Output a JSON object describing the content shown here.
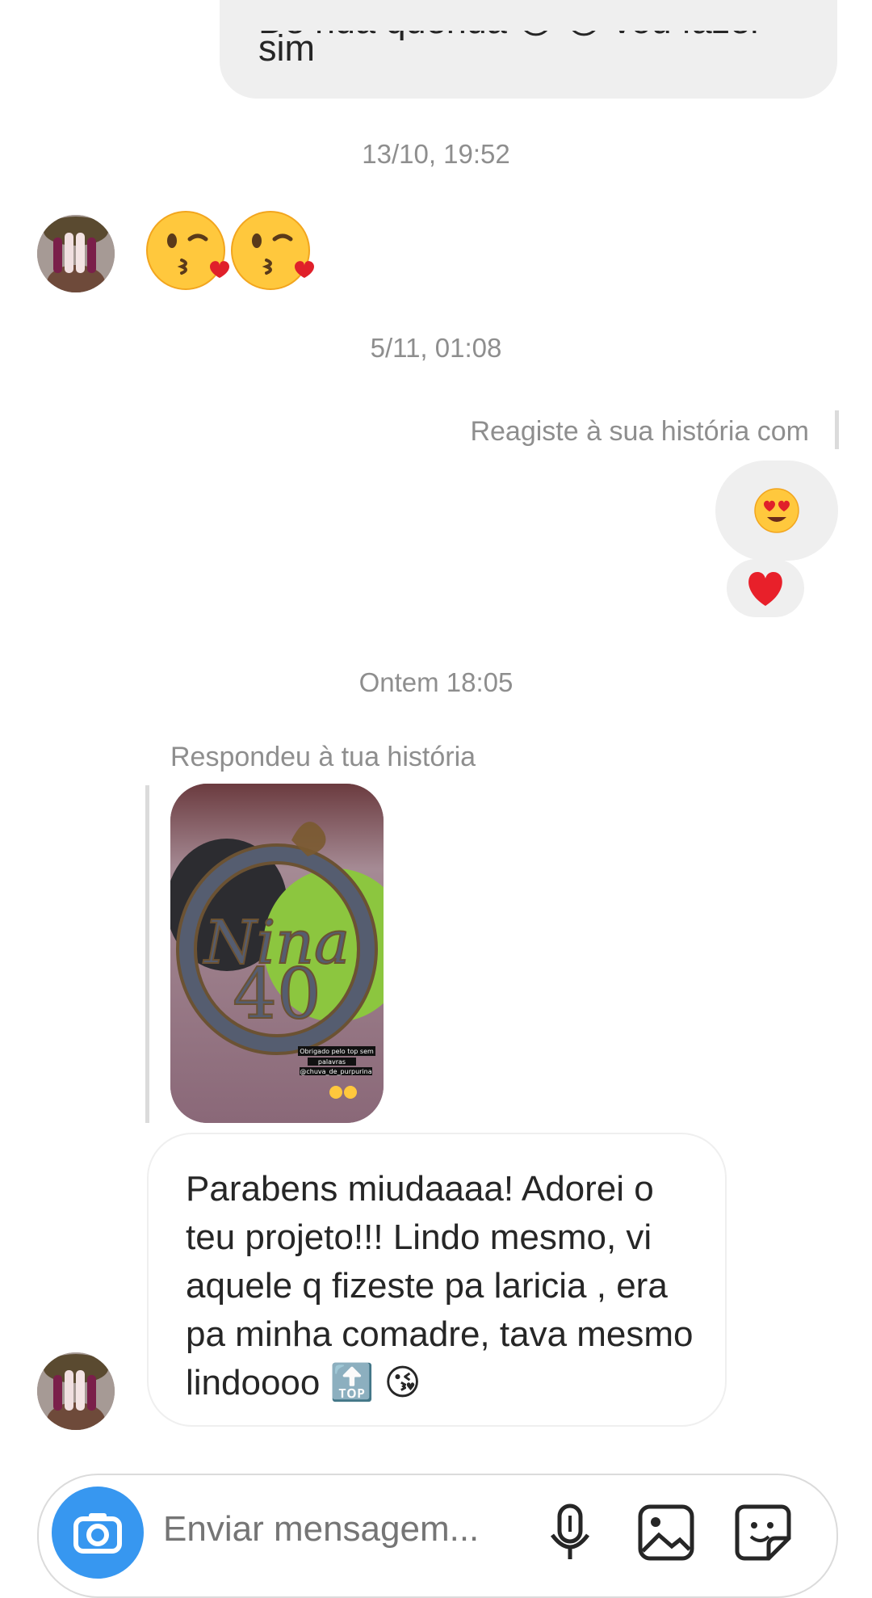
{
  "thread": {
    "top_message": {
      "partial_line": "De nua quenua 😘 😘 vou fazer",
      "text": "sim"
    },
    "timestamps": [
      "13/10, 19:52",
      "5/11, 01:08",
      "Ontem 18:05"
    ],
    "reaction": {
      "label": "Reagiste à sua história com",
      "emoji": "😍",
      "heart": "❤️"
    },
    "story_reply": {
      "label": "Respondeu à tua história",
      "story_caption_line1": "Obrigado pelo top sem",
      "story_caption_line2": "palavras",
      "story_caption_line3": "@chuva_de_purpurina",
      "message": "Parabens miudaaaa! Adorei o teu projeto!!! Lindo mesmo, vi aquele q fizeste pa laricia , era pa minha comadre, tava mesmo lindoooo 🔝 😘"
    }
  },
  "composer": {
    "placeholder": "Enviar mensagem..."
  },
  "colors": {
    "accent": "#3797f0",
    "bubble": "#efefef",
    "timestamp": "#8e8e8e"
  },
  "icons": [
    "camera-icon",
    "microphone-icon",
    "gallery-icon",
    "sticker-icon"
  ]
}
